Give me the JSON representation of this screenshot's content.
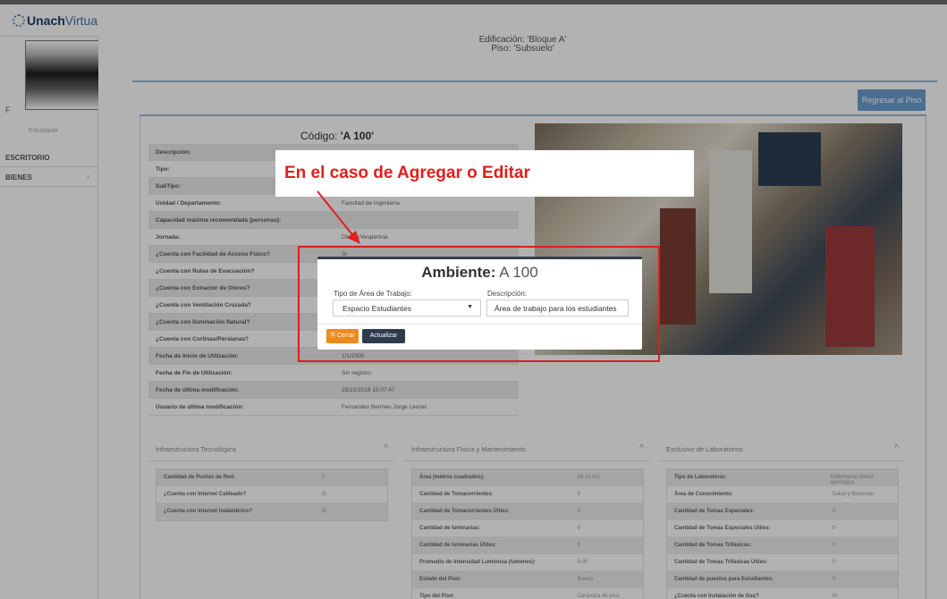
{
  "brand": {
    "part1": "Unach",
    "part2": "Virtual",
    "menu_icon": "≡"
  },
  "sidebar": {
    "f_label": "F",
    "faded_label": "Estudiante",
    "items": [
      {
        "label": "ESCRITORIO"
      },
      {
        "label": "BIENES",
        "chevron": "‹"
      }
    ]
  },
  "header": {
    "building": "Edificación: 'Bloque A'",
    "floor": "Piso: 'Subsuelo'",
    "back_button": "Regresar al Piso"
  },
  "ambiente": {
    "codigo_label": "Código: ",
    "codigo_value": "'A 100'",
    "rows": [
      {
        "k": "Descripción:",
        "v": ""
      },
      {
        "k": "Tipo:",
        "v": ""
      },
      {
        "k": "SubTipo:",
        "v": ""
      },
      {
        "k": "Unidad / Departamento:",
        "v": "Facultad de Ingeniería"
      },
      {
        "k": "Capacidad máxima recomendada (personas):",
        "v": ""
      },
      {
        "k": "Jornada:",
        "v": "Diurna/Vespertina"
      },
      {
        "k": "¿Cuenta con Facilidad de Acceso Físico?",
        "v": "Si"
      },
      {
        "k": "¿Cuenta con Rutas de Evacuación?",
        "v": ""
      },
      {
        "k": "¿Cuenta con Extractor de Olores?",
        "v": ""
      },
      {
        "k": "¿Cuenta con Ventilación Cruzada?",
        "v": ""
      },
      {
        "k": "¿Cuenta con Iluminación Natural?",
        "v": ""
      },
      {
        "k": "¿Cuenta con Cortinas/Persianas?",
        "v": ""
      },
      {
        "k": "Fecha de Inicio de Utilización:",
        "v": "1/1/2000"
      },
      {
        "k": "Fecha de Fin de Utilización:",
        "v": "Sin registro"
      },
      {
        "k": "Fecha de última modificación:",
        "v": "25/10/2018 15:07:47"
      },
      {
        "k": "Usuario de última modificación:",
        "v": "Fernandez Bermeo Jorge Leonel"
      }
    ]
  },
  "sections": [
    {
      "title": "Infraestructura Tecnológica",
      "rows": [
        {
          "k": "Cantidad de Puntos de Red:",
          "v": "3"
        },
        {
          "k": "¿Cuenta con Internet Cableado?",
          "v": "Si"
        },
        {
          "k": "¿Cuenta con Internet Inalámbrico?",
          "v": "Si"
        }
      ]
    },
    {
      "title": "Infraestructura Física y Mantenimiento",
      "rows": [
        {
          "k": "Área (metros cuadrados):",
          "v": "29.19 m2"
        },
        {
          "k": "Cantidad de Tomacorrientes:",
          "v": "0"
        },
        {
          "k": "Cantidad de Tomacorrientes Útiles:",
          "v": "0"
        },
        {
          "k": "Cantidad de luminarias:",
          "v": "0"
        },
        {
          "k": "Cantidad de luminarias Útiles:",
          "v": "0"
        },
        {
          "k": "Promedio de Intensidad Luminosa (lúmenes):",
          "v": "0.00"
        },
        {
          "k": "Estado del Piso:",
          "v": "Bueno"
        },
        {
          "k": "Tipo del Piso:",
          "v": "Cerámica de piso"
        }
      ]
    },
    {
      "title": "Exclusivo de Laboratorios",
      "rows": [
        {
          "k": "Tipo de Laboratorio:",
          "v": "Enfermería clínico quirúrgica"
        },
        {
          "k": "Área de Conocimiento:",
          "v": "Salud y Bienestar"
        },
        {
          "k": "Cantidad de Tomas Especiales:",
          "v": "0"
        },
        {
          "k": "Cantidad de Tomas Especiales Útiles:",
          "v": "0"
        },
        {
          "k": "Cantidad de Tomas Trifásicas:",
          "v": "0"
        },
        {
          "k": "Cantidad de Tomas Trifásicas Útiles:",
          "v": "0"
        },
        {
          "k": "Cantidad de puestos para Estudiantes:",
          "v": "0"
        },
        {
          "k": "¿Cuenta con Instalación de Gas?",
          "v": "Si"
        }
      ]
    }
  ],
  "caret_up": "^",
  "modal": {
    "title_prefix": "Ambiente:",
    "title_code": "A 100",
    "type_label": "Tipo de Área de Trabajo:",
    "type_value": "Espacio Estudiantes",
    "desc_label": "Descripción:",
    "desc_value": "Área de trabajo para los estudiantes",
    "close_button": "🗎 Cerrar",
    "update_button": "Actualizar",
    "select_arrow": "▼"
  },
  "annotation": {
    "callout_text": "En el caso de Agregar o Editar",
    "color": "#e21e1e"
  },
  "colors": {
    "accent": "#6a9ed0",
    "close_button": "#ee8a1c",
    "update_button": "#2d3b4d"
  }
}
